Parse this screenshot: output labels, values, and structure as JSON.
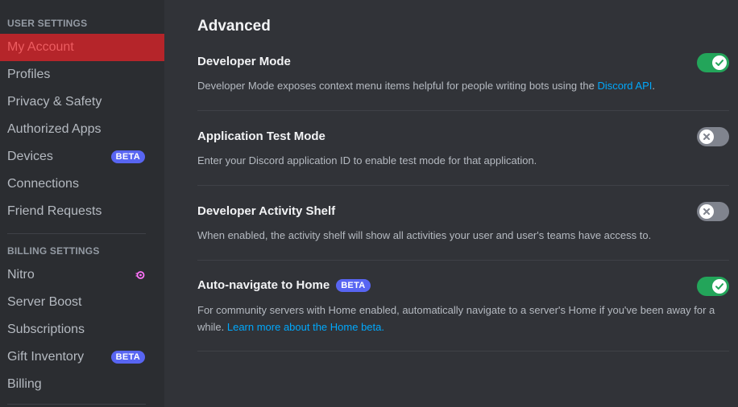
{
  "sidebar": {
    "user_settings_header": "USER SETTINGS",
    "user_items": [
      {
        "label": "My Account",
        "selected": true
      },
      {
        "label": "Profiles"
      },
      {
        "label": "Privacy & Safety"
      },
      {
        "label": "Authorized Apps"
      },
      {
        "label": "Devices",
        "badge": "BETA"
      },
      {
        "label": "Connections"
      },
      {
        "label": "Friend Requests"
      }
    ],
    "billing_settings_header": "BILLING SETTINGS",
    "billing_items": [
      {
        "label": "Nitro",
        "icon": "nitro-icon"
      },
      {
        "label": "Server Boost"
      },
      {
        "label": "Subscriptions"
      },
      {
        "label": "Gift Inventory",
        "badge": "BETA"
      },
      {
        "label": "Billing"
      }
    ]
  },
  "main": {
    "title": "Advanced",
    "settings": [
      {
        "title": "Developer Mode",
        "desc_text": "Developer Mode exposes context menu items helpful for people writing bots using the ",
        "desc_link": "Discord API",
        "desc_suffix": ".",
        "enabled": true
      },
      {
        "title": "Application Test Mode",
        "desc_text": "Enter your Discord application ID to enable test mode for that application.",
        "enabled": false
      },
      {
        "title": "Developer Activity Shelf",
        "desc_text": "When enabled, the activity shelf will show all activities your user and user's teams have access to.",
        "enabled": false
      },
      {
        "title": "Auto-navigate to Home",
        "badge": "BETA",
        "desc_text": "For community servers with Home enabled, automatically navigate to a server's Home if you've been away for a while. ",
        "desc_link": "Learn more about the Home beta.",
        "enabled": true
      }
    ]
  },
  "colors": {
    "toggle_on": "#23a55a",
    "toggle_off": "#80848e",
    "link": "#00a8fc",
    "selected_bg": "#b5252a",
    "badge": "#5865f2"
  }
}
